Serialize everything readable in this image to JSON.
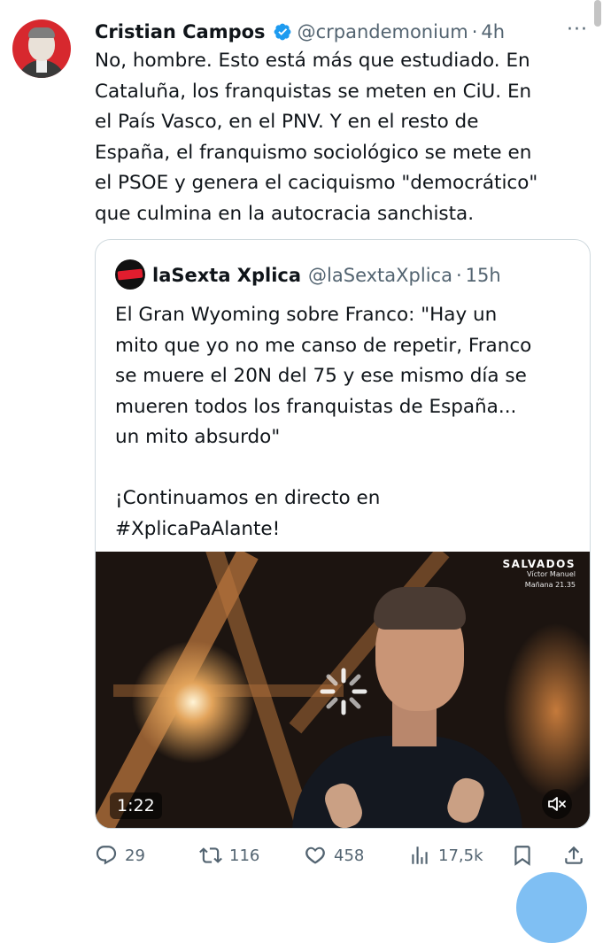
{
  "tweet": {
    "author_name": "Cristian Campos",
    "handle": "@crpandemonium",
    "separator": "·",
    "time": "4h",
    "text": "No, hombre. Esto está más que estudiado. En\nCataluña, los franquistas se meten en CiU. En\nel País Vasco, en el PNV. Y en el resto de\nEspaña, el franquismo sociológico se mete en\nel PSOE y genera el caciquismo \"democrático\"\nque culmina en la autocracia sanchista.",
    "more_label": "···"
  },
  "quote": {
    "author_name": "laSexta Xplica",
    "handle": "@laSextaXplica",
    "separator": "·",
    "time": "15h",
    "text": "El Gran Wyoming sobre Franco: \"Hay un\nmito que yo no me canso de repetir, Franco\nse muere el 20N del 75 y ese mismo día se\nmueren todos los franquistas de España...\nun mito absurdo\"\n\n¡Continuamos en directo en\n#XplicaPaAlante!",
    "video": {
      "duration": "1:22",
      "overlay_title": "SALVADOS",
      "overlay_line1": "Víctor Manuel",
      "overlay_line2": "Mañana 21.35"
    }
  },
  "actions": {
    "replies": "29",
    "retweets": "116",
    "likes": "458",
    "views": "17,5k"
  },
  "colors": {
    "text": "#0f1419",
    "secondary": "#536471",
    "verified": "#1d9bf0",
    "border": "#cfd9de"
  }
}
